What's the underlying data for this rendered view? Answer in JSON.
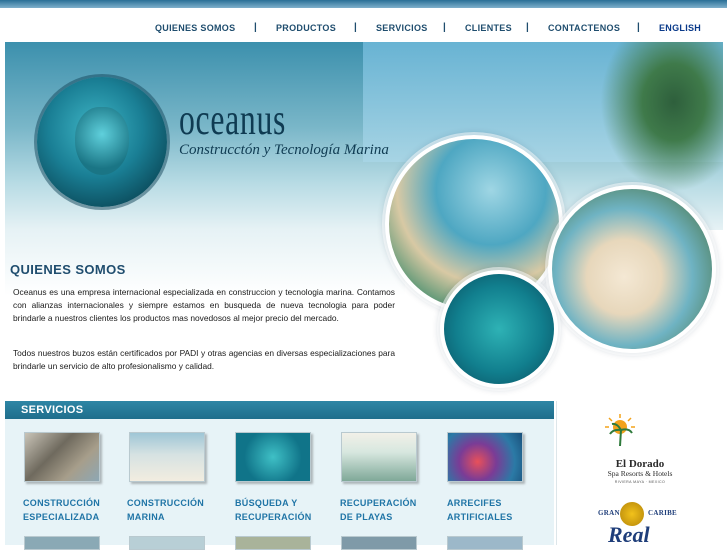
{
  "nav": {
    "items": [
      "QUIENES SOMOS",
      "PRODUCTOS",
      "SERVICIOS",
      "CLIENTES",
      "CONTACTENOS",
      "ENGLISH"
    ],
    "separator": "|"
  },
  "hero": {
    "logo_title": "OCEANUS",
    "logo_subtitle": "Construcctón y Tecnología Marina"
  },
  "about": {
    "title": "QUIENES SOMOS",
    "paragraphs": [
      "Oceanus es una empresa internacional especializada en construccion y tecnologia marina. Contamos con alianzas internacionales y siempre estamos en busqueda de nueva tecnologia para poder brindarle a nuestros clientes los productos mas novedosos al mejor precio del mercado.",
      "Todos nuestros buzos están certificados por PADI y otras agencias en diversas especializaciones para brindarle un servicio de alto profesionalismo y calidad."
    ]
  },
  "services": {
    "title": "SERVICIOS",
    "items": [
      {
        "line1": "CONSTRUCCIÓN",
        "line2": "ESPECIALIZADA"
      },
      {
        "line1": "CONSTRUCCIÓN",
        "line2": "MARINA"
      },
      {
        "line1": "BÚSQUEDA Y",
        "line2": "RECUPERACIÓN"
      },
      {
        "line1": "RECUPERACIÓN",
        "line2": "DE PLAYAS"
      },
      {
        "line1": "ARRECIFES",
        "line2": "ARTIFICIALES"
      }
    ]
  },
  "clients": {
    "eldorado": {
      "name": "El Dorado",
      "subtitle": "Spa Resorts & Hotels",
      "tiny": "RIVIERA MAYA · MEXICO"
    },
    "grancaribe": {
      "word1": "GRAN",
      "word2": "CARIBE",
      "real": "Real"
    }
  },
  "colors": {
    "nav_text": "#1f4d6e",
    "accent": "#1f74a6",
    "services_bar": "#2e86a5"
  },
  "icons": {
    "logo": "neptune-medallion-icon",
    "eldorado": "sun-palm-icon",
    "grancaribe": "check-medallion-icon"
  }
}
